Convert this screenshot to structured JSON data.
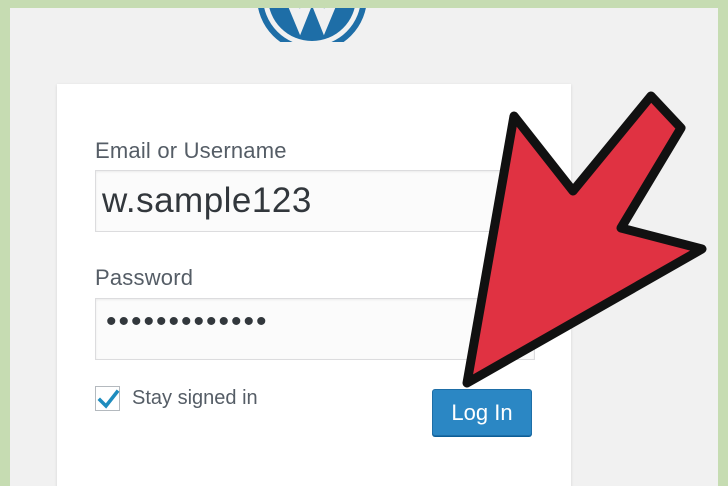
{
  "form": {
    "email_label": "Email or Username",
    "email_value": "w.sample123",
    "password_label": "Password",
    "password_mask": "•••••••••••••",
    "remember_label": "Stay signed in",
    "remember_checked": true,
    "login_label": "Log In"
  },
  "colors": {
    "brand_blue": "#2b87c4",
    "arrow_red": "#e03242",
    "frame_green": "#c6dcb2"
  },
  "icons": {
    "logo": "wordpress-logo",
    "pointer": "pointing-arrow",
    "check": "checkmark-icon"
  }
}
